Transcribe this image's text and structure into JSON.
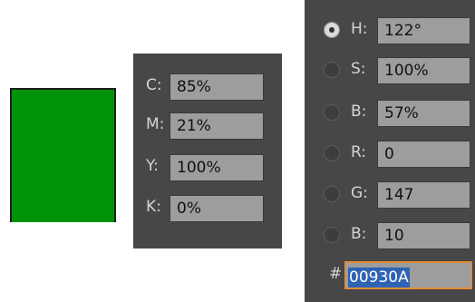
{
  "swatch": {
    "color": "#00930A"
  },
  "cmyk": [
    {
      "label": "C:",
      "value": "85%"
    },
    {
      "label": "M:",
      "value": "21%"
    },
    {
      "label": "Y:",
      "value": "100%"
    },
    {
      "label": "K:",
      "value": "0%"
    }
  ],
  "hsb_rgb": [
    {
      "label": "H:",
      "value": "122°",
      "checked": true
    },
    {
      "label": "S:",
      "value": "100%",
      "checked": false
    },
    {
      "label": "B:",
      "value": "57%",
      "checked": false
    },
    {
      "label": "R:",
      "value": "0",
      "checked": false
    },
    {
      "label": "G:",
      "value": "147",
      "checked": false
    },
    {
      "label": "B:",
      "value": "10",
      "checked": false
    }
  ],
  "hex": {
    "label": "#",
    "value": "00930A"
  },
  "colors": {
    "panel_bg": "#474747",
    "field_bg": "#9d9d9d",
    "selection": "#2f63b4",
    "focus_border": "#e78a37"
  }
}
